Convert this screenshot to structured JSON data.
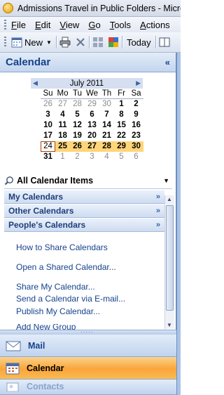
{
  "window": {
    "title": "Admissions Travel in Public Folders - Microso"
  },
  "menubar": {
    "items": [
      {
        "label": "File"
      },
      {
        "label": "Edit"
      },
      {
        "label": "View"
      },
      {
        "label": "Go"
      },
      {
        "label": "Tools"
      },
      {
        "label": "Actions"
      }
    ]
  },
  "toolbar": {
    "new_label": "New",
    "today_label": "Today"
  },
  "nav_pane": {
    "title": "Calendar",
    "collapse_glyph": "«"
  },
  "mini_calendar": {
    "month_label": "July 2011",
    "day_names": [
      "Su",
      "Mo",
      "Tu",
      "We",
      "Th",
      "Fr",
      "Sa"
    ],
    "weeks": [
      [
        "26",
        "27",
        "28",
        "29",
        "30",
        "1",
        "2"
      ],
      [
        "3",
        "4",
        "5",
        "6",
        "7",
        "8",
        "9"
      ],
      [
        "10",
        "11",
        "12",
        "13",
        "14",
        "15",
        "16"
      ],
      [
        "17",
        "18",
        "19",
        "20",
        "21",
        "22",
        "23"
      ],
      [
        "24",
        "25",
        "26",
        "27",
        "28",
        "29",
        "30"
      ],
      [
        "31",
        "1",
        "2",
        "3",
        "4",
        "5",
        "6"
      ]
    ]
  },
  "calendar_view": {
    "label": "All Calendar Items"
  },
  "groups": [
    {
      "label": "My Calendars"
    },
    {
      "label": "Other Calendars"
    },
    {
      "label": "People's Calendars"
    }
  ],
  "links": [
    {
      "label": "How to Share Calendars"
    },
    {
      "label": "Open a Shared Calendar..."
    },
    {
      "label": "Share My Calendar..."
    },
    {
      "label": "Send a Calendar via E-mail..."
    },
    {
      "label": "Publish My Calendar..."
    },
    {
      "label": "Add New Group"
    }
  ],
  "nav_buttons": [
    {
      "label": "Mail"
    },
    {
      "label": "Calendar"
    },
    {
      "label": "Contacts"
    }
  ],
  "colors": {
    "accent": "#15428b",
    "selected_week": "#ffd57a",
    "active_nav": "#f9a53a"
  }
}
